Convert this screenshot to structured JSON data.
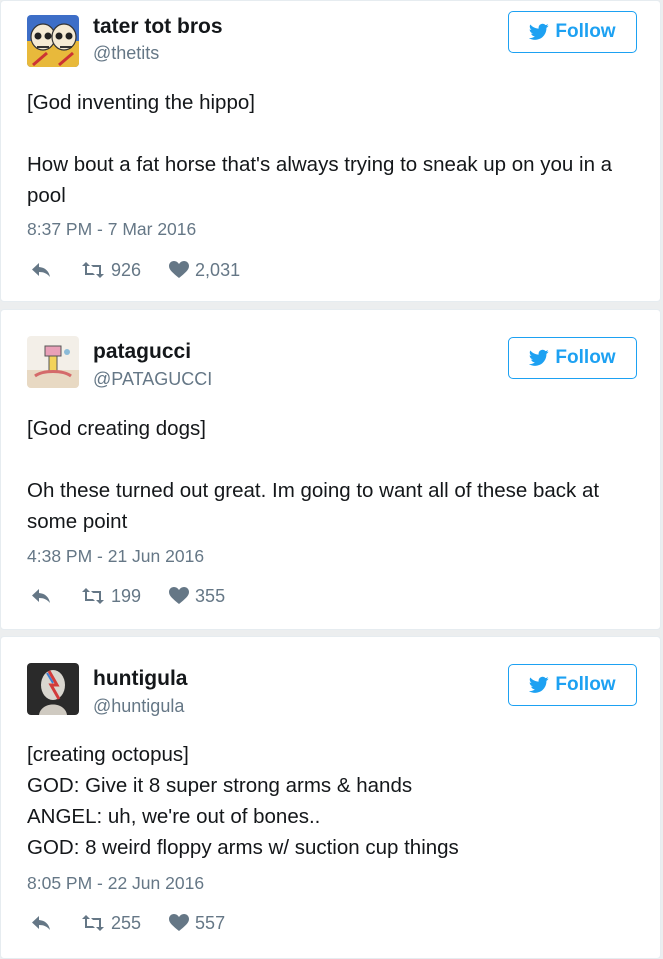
{
  "tweets": [
    {
      "name": "tater tot bros",
      "handle": "@thetits",
      "follow_label": "Follow",
      "body": [
        "[God inventing the hippo]",
        "",
        "How bout a fat horse that's always trying to sneak up on you in a pool"
      ],
      "time": "8:37 PM - 7 Mar 2016",
      "retweets": "926",
      "likes": "2,031",
      "avatar_icon": "two-skulls-avatar"
    },
    {
      "name": "patagucci",
      "handle": "@PATAGUCCI",
      "follow_label": "Follow",
      "body": [
        "[God creating dogs]",
        "",
        "Oh these turned out great. Im going to want all of these back at some point"
      ],
      "time": "4:38 PM - 21 Jun 2016",
      "retweets": "199",
      "likes": "355",
      "avatar_icon": "cartoon-drawing-avatar"
    },
    {
      "name": "huntigula",
      "handle": "@huntigula",
      "follow_label": "Follow",
      "body": [
        "[creating octopus]",
        "GOD: Give it 8 super strong arms & hands",
        "ANGEL: uh, we're out of bones..",
        "GOD: 8 weird floppy arms w/ suction cup things"
      ],
      "time": "8:05 PM - 22 Jun 2016",
      "retweets": "255",
      "likes": "557",
      "avatar_icon": "statue-bust-avatar"
    }
  ],
  "colors": {
    "accent": "#1da1f2",
    "muted": "#657786",
    "text": "#14171a"
  }
}
